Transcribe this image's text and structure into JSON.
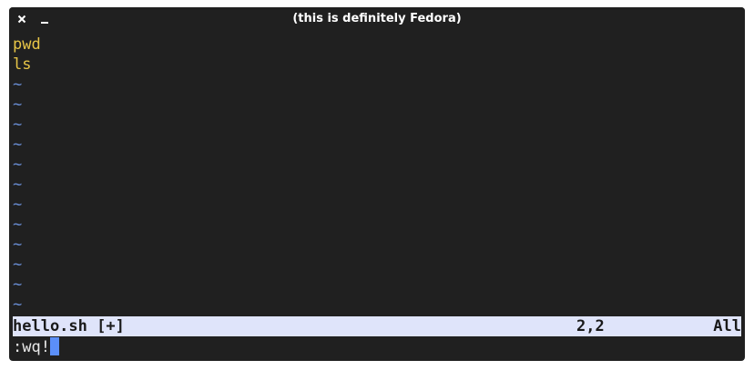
{
  "window": {
    "title": "(this is definitely Fedora)",
    "close_icon": "close-icon",
    "minimize_icon": "minimize-icon"
  },
  "editor": {
    "lines": [
      "pwd",
      "ls"
    ],
    "empty_line_marker": "~"
  },
  "statusline": {
    "filename": "hello.sh [+]",
    "position": "2,2",
    "scroll": "All"
  },
  "cmdline": {
    "text": ":wq!"
  },
  "colors": {
    "background": "#202020",
    "code_text": "#e7c547",
    "tilde": "#6a8fd6",
    "statusline_bg": "#dfe4fa",
    "cursor": "#5b8ff9"
  }
}
